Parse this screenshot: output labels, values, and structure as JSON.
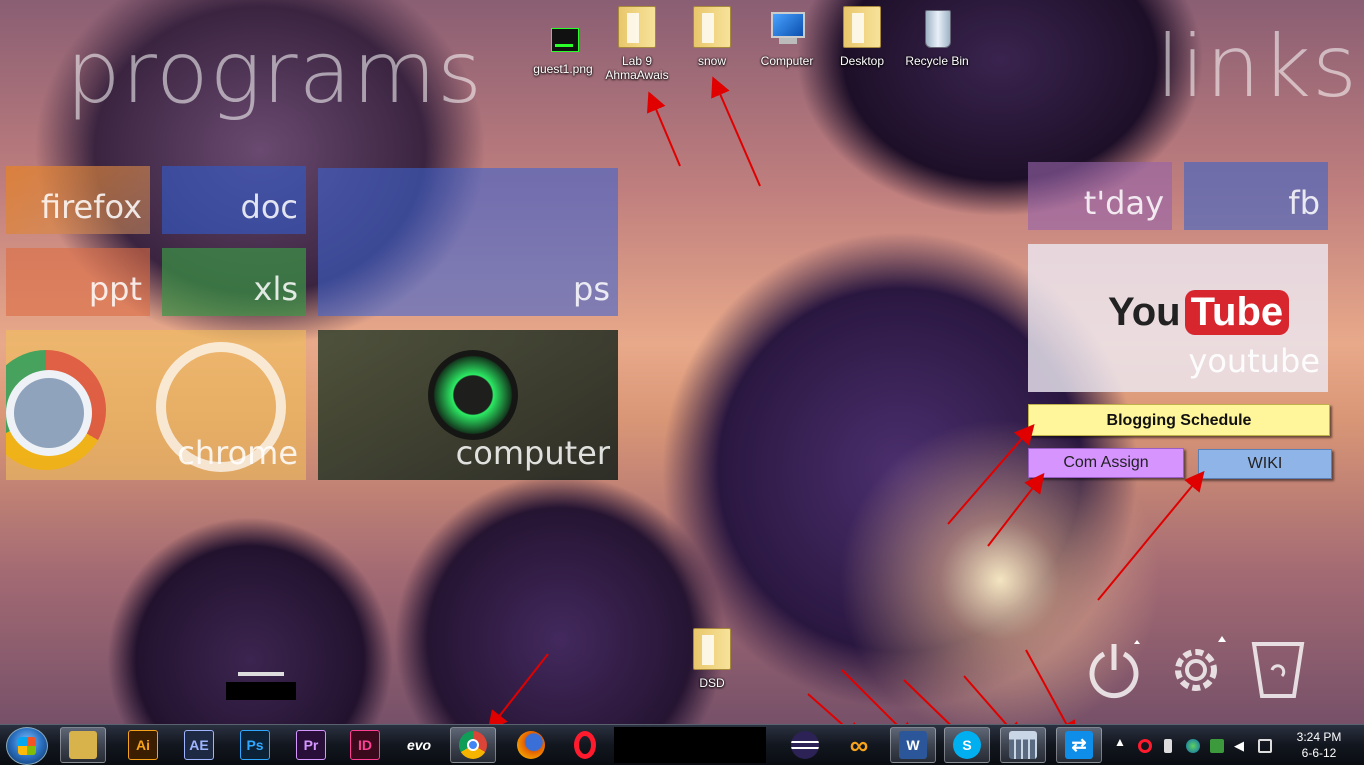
{
  "headings": {
    "programs": "programs",
    "links": "links"
  },
  "desktop_icons": [
    {
      "name": "guest1-icon",
      "label": "guest1.png",
      "type": "image"
    },
    {
      "name": "lab9-folder-icon",
      "label": "Lab 9 AhmaAwais",
      "type": "folder"
    },
    {
      "name": "snow-folder-icon",
      "label": "snow",
      "type": "folder"
    },
    {
      "name": "computer-icon",
      "label": "Computer",
      "type": "computer"
    },
    {
      "name": "desktop-folder-icon",
      "label": "Desktop",
      "type": "folder"
    },
    {
      "name": "recycle-bin-icon",
      "label": "Recycle Bin",
      "type": "bin"
    }
  ],
  "dsd_icon": {
    "label": "DSD"
  },
  "program_tiles": {
    "firefox": "firefox",
    "doc": "doc",
    "ps": "ps",
    "ppt": "ppt",
    "xls": "xls",
    "chrome": "chrome",
    "computer": "computer"
  },
  "link_tiles": {
    "today": "t'day",
    "fb": "fb",
    "youtube_logo_you": "You",
    "youtube_logo_tube": "Tube",
    "youtube": "youtube"
  },
  "buttons": {
    "blogging": "Blogging Schedule",
    "com_assign": "Com Assign",
    "wiki": "WIKI"
  },
  "taskbar": {
    "pinned": [
      {
        "name": "taskbar-explorer",
        "label": "",
        "bg": "#d8b24a"
      },
      {
        "name": "taskbar-illustrator",
        "label": "Ai",
        "bg": "#3b1d00",
        "fg": "#f7a21b"
      },
      {
        "name": "taskbar-after-effects",
        "label": "AE",
        "bg": "#1e2a44",
        "fg": "#9fb4ff"
      },
      {
        "name": "taskbar-photoshop",
        "label": "Ps",
        "bg": "#0b2237",
        "fg": "#31a8ff"
      },
      {
        "name": "taskbar-premiere",
        "label": "Pr",
        "bg": "#2a0e3a",
        "fg": "#d596ff"
      },
      {
        "name": "taskbar-indesign",
        "label": "ID",
        "bg": "#3a0a1c",
        "fg": "#ff3f94"
      },
      {
        "name": "taskbar-evo",
        "label": "evo",
        "bg": "transparent",
        "fg": "#ffffff"
      },
      {
        "name": "taskbar-chrome",
        "label": "",
        "bg": "#ffffff"
      },
      {
        "name": "taskbar-firefox",
        "label": "",
        "bg": "#e66000"
      },
      {
        "name": "taskbar-opera",
        "label": "O",
        "bg": "transparent",
        "fg": "#ff1b2d"
      }
    ],
    "running": [
      {
        "name": "taskbar-eclipse",
        "label": "",
        "bg": "#2c2255"
      },
      {
        "name": "taskbar-infinity",
        "label": "∞",
        "bg": "transparent",
        "fg": "#f7a21b"
      },
      {
        "name": "taskbar-word",
        "label": "W",
        "bg": "#2b579a",
        "fg": "#ffffff"
      },
      {
        "name": "taskbar-skype",
        "label": "S",
        "bg": "#00aff0",
        "fg": "#ffffff"
      },
      {
        "name": "taskbar-calculator",
        "label": "",
        "bg": "#c9d6e6"
      },
      {
        "name": "taskbar-teamviewer",
        "label": "",
        "bg": "#0e8ee9"
      }
    ],
    "clock": {
      "time": "3:24 PM",
      "date": "6-6-12"
    }
  }
}
